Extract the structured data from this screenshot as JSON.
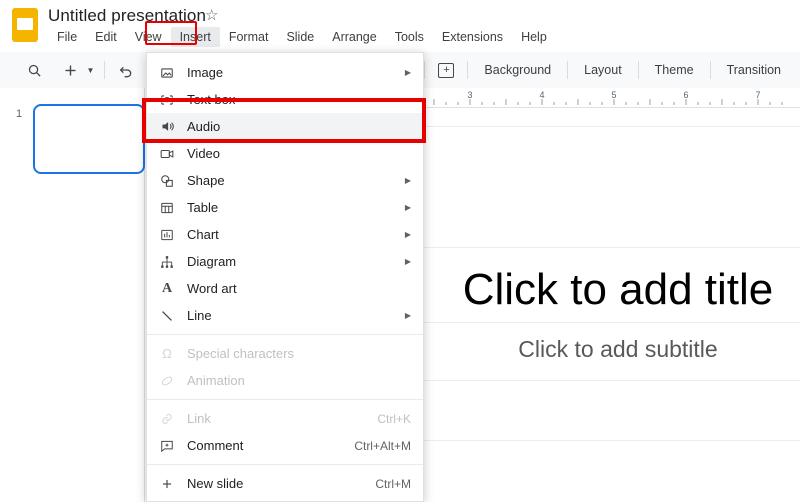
{
  "app": {
    "logo_icon": "google-slides-logo",
    "doc_title": "Untitled presentation",
    "star_icon": "☆"
  },
  "menubar": {
    "items": [
      {
        "label": "File"
      },
      {
        "label": "Edit"
      },
      {
        "label": "View"
      },
      {
        "label": "Insert"
      },
      {
        "label": "Format"
      },
      {
        "label": "Slide"
      },
      {
        "label": "Arrange"
      },
      {
        "label": "Tools"
      },
      {
        "label": "Extensions"
      },
      {
        "label": "Help"
      }
    ],
    "active": "Insert",
    "highlight_color": "#e60000"
  },
  "toolbar": {
    "search_icon": "search-icon",
    "new_slide_icon": "plus-icon",
    "new_slide_caret": "▼",
    "undo_icon": "undo-icon",
    "redo_icon": "redo-icon",
    "line_caret": "▼",
    "comment_icon": "add-comment-icon",
    "buttons": [
      {
        "label": "Background"
      },
      {
        "label": "Layout"
      },
      {
        "label": "Theme"
      },
      {
        "label": "Transition"
      }
    ]
  },
  "ruler": {
    "labels": [
      "3",
      "4",
      "5",
      "6",
      "7"
    ]
  },
  "filmstrip": {
    "slide_number": "1"
  },
  "canvas": {
    "title_placeholder": "Click to add title",
    "subtitle_placeholder": "Click to add subtitle"
  },
  "insert_menu": {
    "groups": [
      {
        "items": [
          {
            "icon": "image-icon",
            "label": "Image",
            "shortcut": "",
            "submenu": true,
            "disabled": false,
            "highlighted": false
          },
          {
            "icon": "textbox-icon",
            "label": "Text box",
            "shortcut": "",
            "submenu": false,
            "disabled": false,
            "highlighted": false
          },
          {
            "icon": "audio-icon",
            "label": "Audio",
            "shortcut": "",
            "submenu": false,
            "disabled": false,
            "highlighted": true
          },
          {
            "icon": "video-icon",
            "label": "Video",
            "shortcut": "",
            "submenu": false,
            "disabled": false,
            "highlighted": false
          },
          {
            "icon": "shape-icon",
            "label": "Shape",
            "shortcut": "",
            "submenu": true,
            "disabled": false,
            "highlighted": false
          },
          {
            "icon": "table-icon",
            "label": "Table",
            "shortcut": "",
            "submenu": true,
            "disabled": false,
            "highlighted": false
          },
          {
            "icon": "chart-icon",
            "label": "Chart",
            "shortcut": "",
            "submenu": true,
            "disabled": false,
            "highlighted": false
          },
          {
            "icon": "diagram-icon",
            "label": "Diagram",
            "shortcut": "",
            "submenu": true,
            "disabled": false,
            "highlighted": false
          },
          {
            "icon": "wordart-icon",
            "label": "Word art",
            "shortcut": "",
            "submenu": false,
            "disabled": false,
            "highlighted": false
          },
          {
            "icon": "line-icon",
            "label": "Line",
            "shortcut": "",
            "submenu": true,
            "disabled": false,
            "highlighted": false
          }
        ]
      },
      {
        "items": [
          {
            "icon": "omega-icon",
            "label": "Special characters",
            "shortcut": "",
            "submenu": false,
            "disabled": true,
            "highlighted": false
          },
          {
            "icon": "animation-icon",
            "label": "Animation",
            "shortcut": "",
            "submenu": false,
            "disabled": true,
            "highlighted": false
          }
        ]
      },
      {
        "items": [
          {
            "icon": "link-icon",
            "label": "Link",
            "shortcut": "Ctrl+K",
            "submenu": false,
            "disabled": true,
            "highlighted": false
          },
          {
            "icon": "comment-icon",
            "label": "Comment",
            "shortcut": "Ctrl+Alt+M",
            "submenu": false,
            "disabled": false,
            "highlighted": false
          }
        ]
      },
      {
        "items": [
          {
            "icon": "plus-icon",
            "label": "New slide",
            "shortcut": "Ctrl+M",
            "submenu": false,
            "disabled": false,
            "highlighted": false
          }
        ]
      }
    ],
    "highlight_color": "#e60000",
    "highlight_row": "Audio"
  }
}
